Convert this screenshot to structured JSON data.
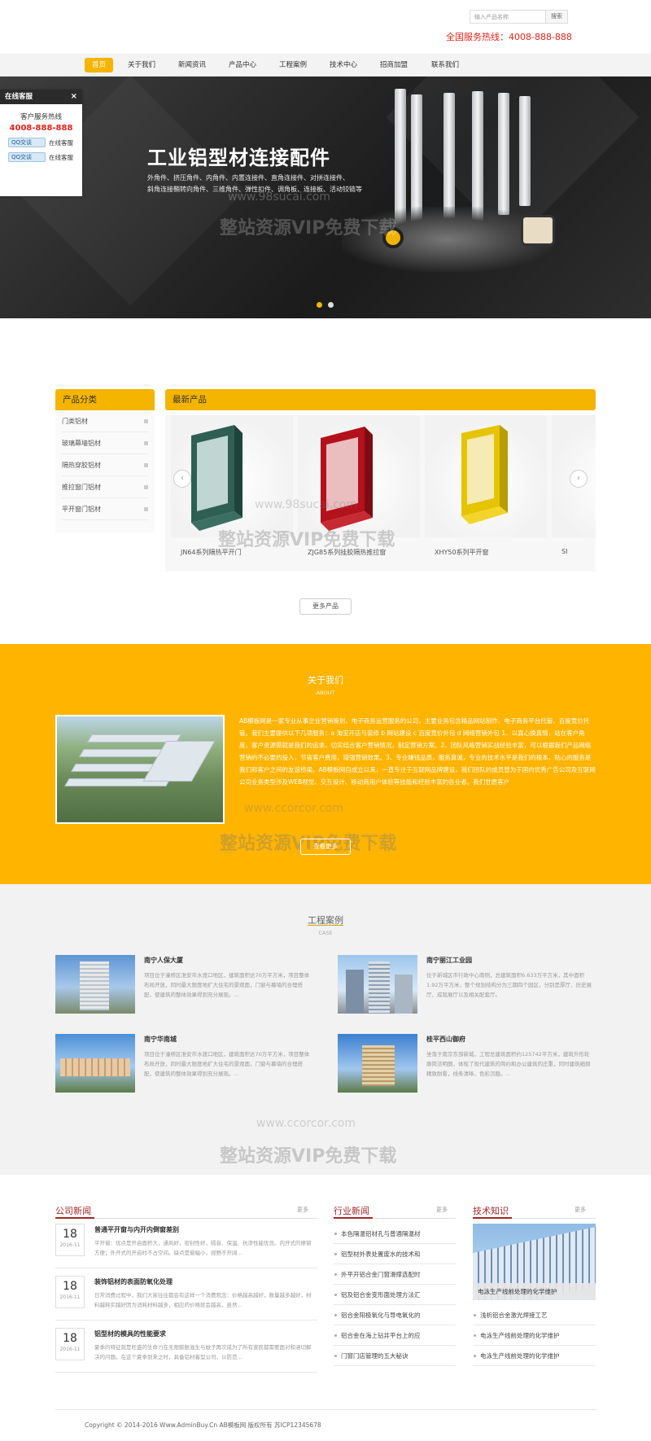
{
  "header": {
    "search_placeholder": "输入产品名称",
    "search_button": "搜索",
    "hotline": "全国服务热线：4008-888-888"
  },
  "nav": [
    "首页",
    "关于我们",
    "新闻资讯",
    "产品中心",
    "工程案例",
    "技术中心",
    "招商加盟",
    "联系我们"
  ],
  "banner": {
    "title": "工业铝型材连接配件",
    "line1": "外角件、挤压角件、内角件、内置连接件、直角连接件、对拼连接件、",
    "line2": "斜角连接鞘转向角件、三维角件、弹性扣件、调角板、连接板、活动铰链等",
    "active_slide": 1,
    "slides": 2
  },
  "qq_panel": {
    "title": "在线客服",
    "close": "×",
    "label": "客户服务热线",
    "phone": "4008-888-888",
    "rows": [
      {
        "btn": "QQ交谈",
        "text": "在线客服"
      },
      {
        "btn": "QQ交谈",
        "text": "在线客服"
      }
    ]
  },
  "products": {
    "category_title": "产品分类",
    "categories": [
      "门类铝材",
      "玻璃幕墙铝材",
      "隔热穿胶铝材",
      "推拉窗门铝材",
      "平开窗门铝材"
    ],
    "latest_title": "最新产品",
    "items": [
      {
        "caption": "JN64系列隔热平开门",
        "color": "#2f5f52"
      },
      {
        "caption": "ZJG85系列挂胶隔热推拉窗",
        "color": "#b3121c"
      },
      {
        "caption": "XHY50系列平开窗",
        "color": "#e5c400"
      },
      {
        "caption": "SI",
        "color": "#bbbbbb"
      }
    ],
    "prev": "‹",
    "next": "›",
    "more": "更多产品"
  },
  "about": {
    "title": "关于我们",
    "subtitle": "ABOUT",
    "text": "AB模板网是一家专业从事企业营销策划、电子商务运营服务的公司，主要业务包含精品网站制作、电子商务平台托管、百度竞价托管。我们主要提供以下几项服务：a 淘宝开店与装修 b 网站建设 c 百度竞价外包 d 网络营销外包 1、以真心换真情，站在客户角度，客户资源需就是我们的追求，切实结合客户营销情况，制定营销方案。2、团队风格营销实战经验丰富，可以根据我们产品网络营销的不必要的投入，节省客户费用，增强营销效果。3、专业赚钱品质，服务真诚，专业的技术水平是我们的根本，贴心的服务是我们和客户之间的友谊桥梁。AB模板网自成立以来，一直专注于互联网品牌建设，我们团队的成员曾为于国内优秀广告公司及互联网公司业务类型涉及WEB视觉、交互设计、移动商用户体验等技能和经验丰富的各业者。我们甘愿客户",
    "more": "查看更多"
  },
  "cases": {
    "title": "工程案例",
    "subtitle": "CASE",
    "items": [
      {
        "name": "南宁人保大厦",
        "desc": "项目位于潼桥区淮安市水渡口地区，建筑面积达70万平方米，项目整体布局开放，同时最大限度地扩大住宅的景观面，门窗与幕墙的合理搭配，使建筑的整体效果得到充分展现。..."
      },
      {
        "name": "南宁丽江工业园",
        "desc": "位于新城区市行政中心南侧，总建筑面积6.633万平方米，其中面积1.92万平方米，整个规划结构分为三期四个园区，分别是厚厅、历史展厅、成就展厅以及相关配套厅。"
      },
      {
        "name": "南宁华南城",
        "desc": "项目位于潼桥区淮安市水渡口地区，建筑面积达70万平方米，项目整体布局开放，同时最大限度地扩大住宅的景观面，门窗与幕墙的合理搭配，使建筑的整体效果得到充分展现。..."
      },
      {
        "name": "桂平西山御府",
        "desc": "坐落于南京东部新城，工程总建筑面积约125742平方米，建筑外形轮廓简洁明朗，体现了现代建筑的简约和办公建筑的庄重，同时建筑细部精致耐看，线条清晰，色彩沉稳。..."
      }
    ]
  },
  "company_news": {
    "title": "公司新闻",
    "more": "更多",
    "items": [
      {
        "day": "18",
        "ym": "2016-11",
        "title": "普通平开窗与内开内倒窗差别",
        "desc": "平开窗：优点是开启面积大，通风好，密封性好，隔音、保温、抗渗性能优良。内开式的擦窗方便；外开式的开启时不占空间。缺点是窗幅小，视野不开阔..."
      },
      {
        "day": "18",
        "ym": "2016-11",
        "title": "装饰铝材的表面防氧化处理",
        "desc": "日常消费过程中，我们大家往往都会有这样一个消费观念：价格越高越好，数量越多越好，材料越耗实越好因为消耗材料越多，相应的价格就会越高，虽然..."
      },
      {
        "day": "18",
        "ym": "2016-11",
        "title": "铝型材的模具的性能要求",
        "desc": "夏季的特征就是旺盛的生命力在无限膨胀滋生与蚊子再次成为了所有害民都需要面对和涵切解决的问题。在这个夏季到来之时，具备铝材着型公司，以防范..."
      }
    ]
  },
  "industry_news": {
    "title": "行业新闻",
    "more": "更多",
    "items": [
      "本色隔温铝材孔与普通隔温材",
      "铝型材外表处置废水的技术和",
      "外平开铝合金门窗滑撑选配时",
      "铝及铝合金变形面处理方法汇",
      "铝合金阳极氧化与导电氧化的",
      "铝合金在海上钻井平台上的应",
      "门窗门店管理的五大秘诀"
    ]
  },
  "tech": {
    "title": "技术知识",
    "more": "更多",
    "feature_caption": "电泳生产线前处理的化学维护",
    "items": [
      "浅析铝合金激光焊接工艺",
      "电泳生产线前处理的化学维护",
      "电泳生产线前处理的化学维护"
    ]
  },
  "footer": {
    "copyright": "Copyright © 2014-2016 Www.AdminBuy.Cn AB模板网 版权所有    苏ICP12345678"
  },
  "watermark": {
    "url1": "www.98sucai.com",
    "text": "整站资源VIP免费下载",
    "url2": "www.ccorcor.com"
  },
  "colors": {
    "accent": "#f5b400",
    "about_bg": "#ffb400",
    "hotline": "#e2231a",
    "news_title": "#a0282a"
  }
}
